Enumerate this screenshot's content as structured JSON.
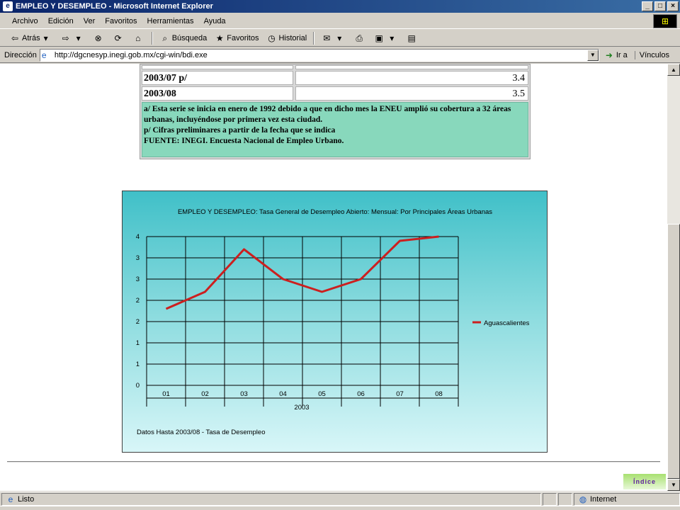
{
  "window": {
    "title": "EMPLEO Y DESEMPLEO - Microsoft Internet Explorer"
  },
  "menu": [
    "Archivo",
    "Edición",
    "Ver",
    "Favoritos",
    "Herramientas",
    "Ayuda"
  ],
  "toolbar": {
    "back": "Atrás",
    "search": "Búsqueda",
    "favorites": "Favoritos",
    "history": "Historial"
  },
  "address": {
    "label": "Dirección",
    "url": "http://dgcnesyp.inegi.gob.mx/cgi-win/bdi.exe",
    "go": "Ir a",
    "links": "Vínculos"
  },
  "table": {
    "rows": [
      {
        "label": "2003/07 p/",
        "value": "3.4"
      },
      {
        "label": "2003/08",
        "value": "3.5"
      }
    ],
    "notes": [
      "a/ Esta serie se inicia en enero de 1992 debido a que en dicho mes la ENEU amplió su cobertura a 32 áreas urbanas, incluyéndose por primera vez esta ciudad.",
      "p/ Cifras preliminares a partir de la fecha que se indica",
      "FUENTE: INEGI. Encuesta Nacional de Empleo Urbano."
    ]
  },
  "chart_data": {
    "type": "line",
    "title": "EMPLEO Y DESEMPLEO: Tasa General de Desempleo Abierto: Mensual: Por Principales Áreas Urbanas",
    "categories": [
      "01",
      "02",
      "03",
      "04",
      "05",
      "06",
      "07",
      "08"
    ],
    "xlabel": "2003",
    "yticks": [
      "0",
      "1",
      "1",
      "2",
      "2",
      "3",
      "3",
      "4"
    ],
    "ylim": [
      0,
      3.5
    ],
    "series": [
      {
        "name": "Aguascalientes",
        "color": "#cc1f1f",
        "values": [
          1.8,
          2.2,
          3.2,
          2.5,
          2.2,
          2.5,
          3.4,
          3.5
        ]
      }
    ],
    "footnote": "Datos Hasta 2003/08 - Tasa de Desempleo",
    "legend": "right",
    "grid": true
  },
  "footer": {
    "indice": "Índice"
  },
  "status": {
    "text": "Listo",
    "zone": "Internet"
  }
}
